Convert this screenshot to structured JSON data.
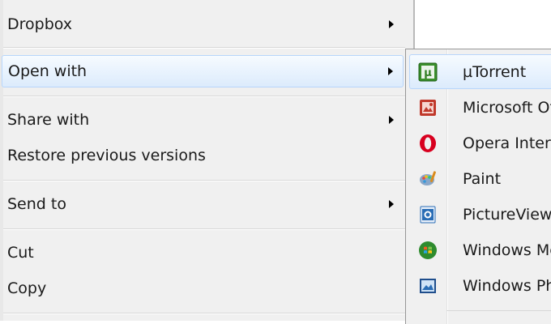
{
  "menu": {
    "items": [
      {
        "label": "Dropbox",
        "has_submenu": true
      },
      {
        "label": "Open with",
        "has_submenu": true
      },
      {
        "label": "Share with",
        "has_submenu": true
      },
      {
        "label": "Restore previous versions",
        "has_submenu": false
      },
      {
        "label": "Send to",
        "has_submenu": true
      },
      {
        "label": "Cut",
        "has_submenu": false
      },
      {
        "label": "Copy",
        "has_submenu": false
      }
    ]
  },
  "submenu": {
    "items": [
      {
        "label": "µTorrent",
        "icon": "utorrent-icon"
      },
      {
        "label": "Microsoft Office Picture Manager",
        "icon": "picture-manager-icon"
      },
      {
        "label": "Opera Internet Browser",
        "icon": "opera-icon"
      },
      {
        "label": "Paint",
        "icon": "paint-icon"
      },
      {
        "label": "PictureViewer",
        "icon": "pictureviewer-icon"
      },
      {
        "label": "Windows Media Center",
        "icon": "windows-media-center-icon"
      },
      {
        "label": "Windows Photo Viewer",
        "icon": "windows-photo-viewer-icon"
      }
    ]
  },
  "colors": {
    "menu_bg": "#f0f0f0",
    "hover_border": "#b8d6fb",
    "hover_bg_top": "#f6fbff",
    "hover_bg_bottom": "#dcebfc",
    "utorrent_green": "#3a8f2b",
    "opera_red": "#d8001f"
  }
}
